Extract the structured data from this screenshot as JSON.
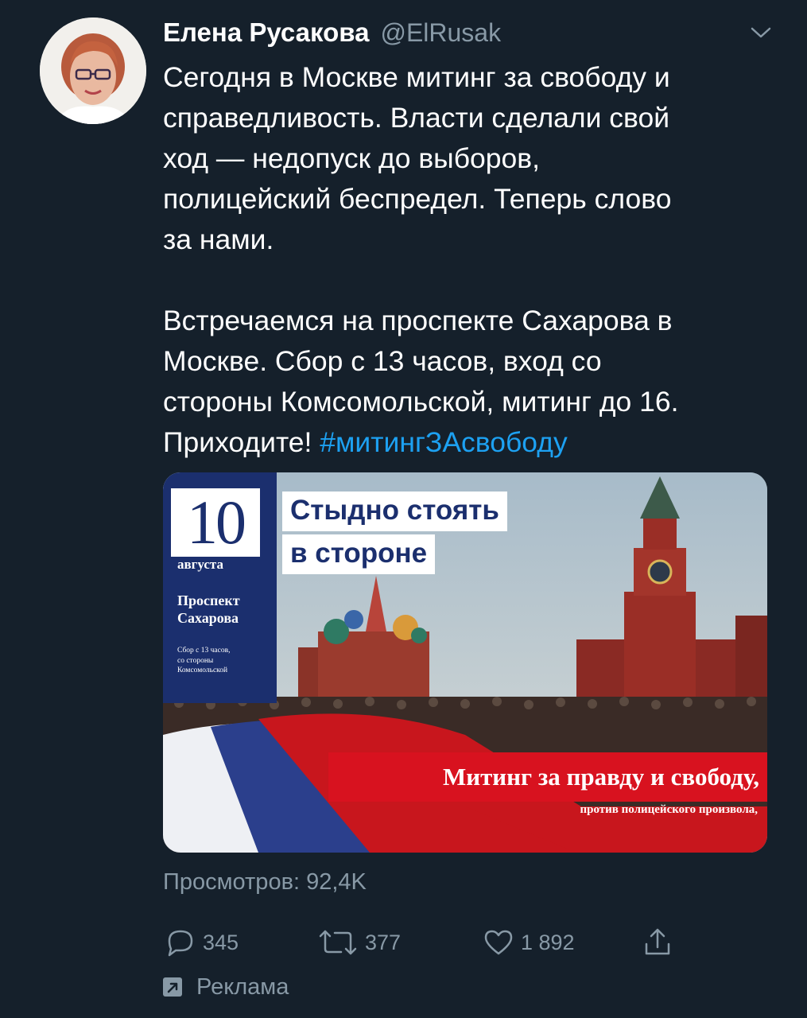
{
  "author": {
    "name": "Елена Русакова",
    "handle": "@ElRusak"
  },
  "tweet": {
    "text": "Сегодня в Москве митинг за свободу и\nсправедливость. Власти сделали свой\nход — недопуск до выборов,\nполицейский беспредел. Теперь слово\nза нами.\n\nВстречаемся на проспекте Сахарова в\nМоскве. Сбор с 13 часов, вход со\nстороны Комсомольской, митинг до 16.\nПриходите! ",
    "hashtag": "#митингЗАсвободу"
  },
  "media": {
    "date_number": "10",
    "date_month": "августа",
    "place": "Проспект\nСахарова",
    "gather": "Сбор с 13 часов,\nсо стороны\nКомсомольской",
    "slogan_line1": "Стыдно стоять",
    "slogan_line2": "в стороне",
    "banner_main": "Митинг за правду и свободу,",
    "banner_sub": "против полицейского произвола,"
  },
  "stats": {
    "views": "Просмотров: 92,4K"
  },
  "actions": {
    "replies": "345",
    "retweets": "377",
    "likes": "1 892"
  },
  "promo": {
    "label": "Реклама"
  },
  "colors": {
    "background": "#15202b",
    "secondary_text": "#8899a6",
    "link": "#1da1f2",
    "poster_blue": "#1b2f6e",
    "poster_red": "#d8121f"
  }
}
